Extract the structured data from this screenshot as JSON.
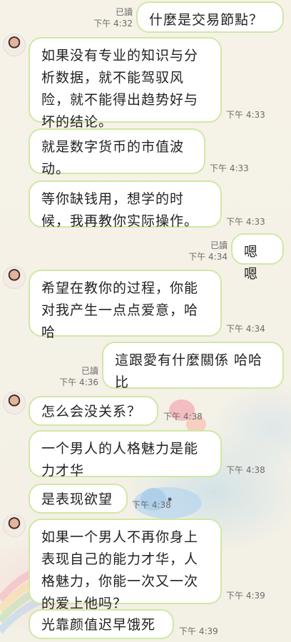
{
  "messages": [
    {
      "side": "right",
      "text": "什麼是交易節點？",
      "read": "已讀",
      "time": "下午 4:32"
    },
    {
      "side": "left",
      "text": "如果没有专业的知识与分\n析数据，就不能驾驭风\n险，就不能得出趋势好与\n坏的结论。",
      "time": "下午 4:33"
    },
    {
      "side": "left",
      "text": "就是数字货币的市值波\n动。",
      "time": "下午 4:33"
    },
    {
      "side": "left",
      "text": "等你缺钱用，想学的时\n候，我再教你实际操作。",
      "time": "下午 4:33"
    },
    {
      "side": "right",
      "text": "嗯嗯",
      "read": "已讀",
      "time": "下午 4:34"
    },
    {
      "side": "left",
      "text": "希望在教你的过程，你能\n对我产生一点点爱意，哈\n哈",
      "time": "下午 4:34"
    },
    {
      "side": "right",
      "text": "這跟愛有什麼關係 哈哈\n比",
      "read": "已讀",
      "time": "下午 4:36"
    },
    {
      "side": "left",
      "text": "怎么会没关系？",
      "time": "下午 4:38"
    },
    {
      "side": "left",
      "text": "一个男人的人格魅力是能\n力才华",
      "time": "下午 4:38"
    },
    {
      "side": "left",
      "text": "是表现欲望",
      "time": "下午 4:38"
    },
    {
      "side": "left",
      "text": "如果一个男人不再你身上\n表现自己的能力才华，人\n格魅力，你能一次又一次\n的爱上他吗？",
      "time": "下午 4:39"
    },
    {
      "side": "left",
      "text": "光靠颜值迟早饿死",
      "time": "下午 4:39"
    }
  ]
}
